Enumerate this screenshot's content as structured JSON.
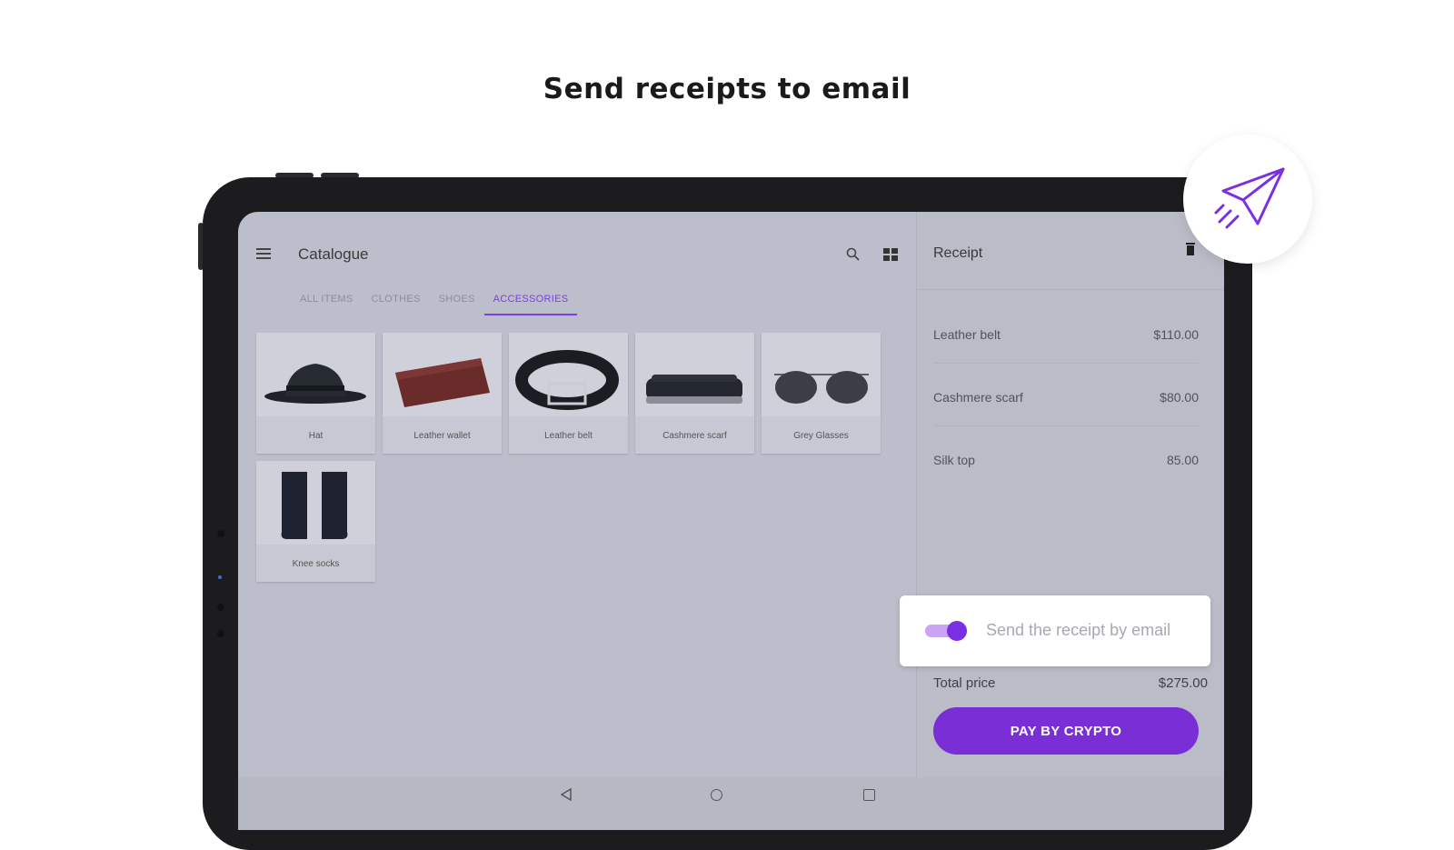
{
  "headline": "Send receipts to email",
  "catalogue": {
    "title": "Catalogue",
    "tabs": [
      "ALL ITEMS",
      "CLOTHES",
      "SHOES",
      "ACCESSORIES"
    ],
    "active_tab": "ACCESSORIES",
    "products": [
      {
        "label": "Hat"
      },
      {
        "label": "Leather wallet"
      },
      {
        "label": "Leather belt"
      },
      {
        "label": "Cashmere scarf"
      },
      {
        "label": "Grey Glasses"
      },
      {
        "label": "Knee socks"
      }
    ]
  },
  "receipt": {
    "title": "Receipt",
    "items": [
      {
        "name": "Leather belt",
        "price": "$110.00"
      },
      {
        "name": "Cashmere scarf",
        "price": "$80.00"
      },
      {
        "name": "Silk top",
        "price": "85.00"
      }
    ],
    "total_label": "Total price",
    "total_value": "$275.00",
    "pay_label": "PAY BY CRYPTO"
  },
  "email_toggle": {
    "label": "Send the receipt by email",
    "enabled": true
  },
  "colors": {
    "accent": "#7a2fd6",
    "screen_bg": "#bcbecb",
    "toggle_track": "#c8a4f3"
  },
  "icons": [
    "menu-icon",
    "search-icon",
    "grid-view-icon",
    "trash-icon",
    "paper-plane-icon",
    "nav-back-icon",
    "nav-home-icon",
    "nav-recent-icon"
  ]
}
